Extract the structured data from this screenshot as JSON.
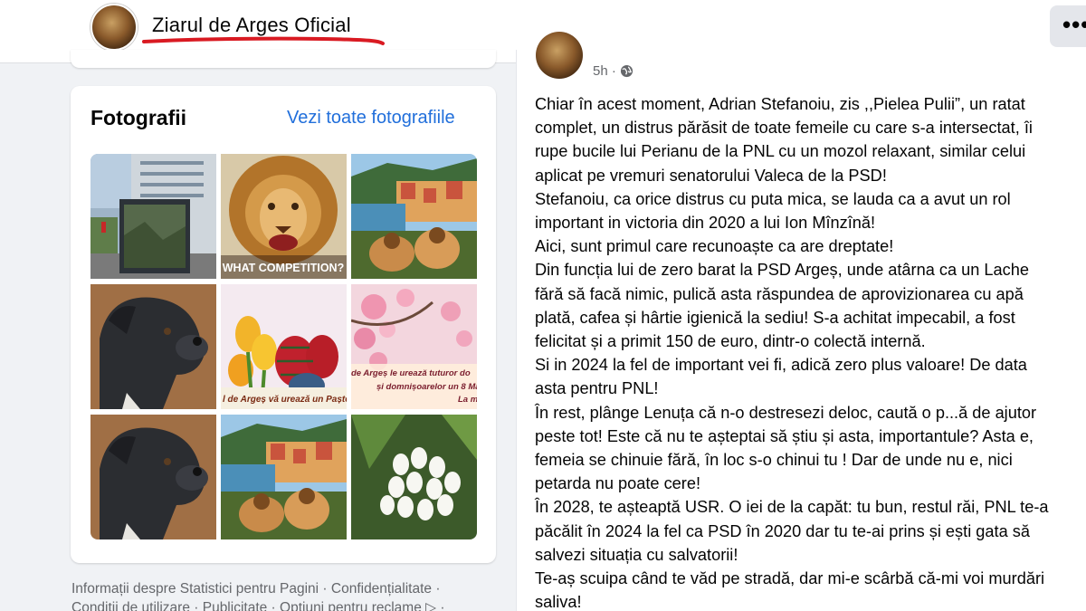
{
  "header": {
    "page_name": "Ziarul de Arges Oficial",
    "more_label": "•••",
    "underline_color": "#d91a22"
  },
  "photos": {
    "title": "Fotografii",
    "see_all": "Vezi toate fotografiile",
    "items": [
      {
        "caption": ""
      },
      {
        "caption": "WHAT COMPETITION?"
      },
      {
        "caption": ""
      },
      {
        "caption": ""
      },
      {
        "caption": "l de Argeș vă urează un Paște"
      },
      {
        "caption_line1": "de Argeș le urează tuturor do",
        "caption_line2": "și domnișoarelor un 8 Mar",
        "caption_line3": "La m"
      },
      {
        "caption": ""
      },
      {
        "caption": ""
      },
      {
        "caption": ""
      }
    ]
  },
  "footer": {
    "line1": "Informații despre Statistici pentru Pagini · Confidențialitate ·",
    "line2": "Condiții de utilizare · Publicitate · Opțiuni pentru reclame ▷ ·"
  },
  "post": {
    "time": "5h ·",
    "lines": [
      "Chiar în acest moment, Adrian Stefanoiu, zis ,,Pielea Pulii”, un ratat",
      "complet, un distrus părăsit de toate femeile cu care s-a intersectat, îi",
      "rupe bucile lui Perianu de la PNL cu un mozol relaxant, similar celui",
      "aplicat pe vremuri senatorului Valeca de la PSD!",
      "Stefanoiu, ca orice distrus cu puta mica, se lauda ca a avut un rol",
      "important in victoria din 2020 a lui Ion Mînzînă!",
      "Aici, sunt primul care recunoaște ca are dreptate!",
      "Din funcția lui de zero barat la PSD Argeș, unde atârna ca un Lache",
      "fără să facă nimic, pulică asta răspundea de aprovizionarea cu apă",
      "plată, cafea și hârtie igienică la sediu! S-a achitat impecabil, a fost",
      "felicitat și a primit 150 de euro, dintr-o colectă internă.",
      "Si in 2024 la fel de important vei fi, adică zero plus valoare! De data",
      "asta pentru PNL!",
      "În rest, plânge Lenuța că n-o destresezi deloc, caută o  p...ă de ajutor",
      "peste tot! Este că nu te așteptai să știu și asta, importantule? Asta e,",
      "femeia se chinuie fără, în loc s-o chinui tu ! Dar de unde nu e, nici",
      "petarda nu poate cere!",
      "În 2028, te așteaptă USR. O iei de la capăt: tu bun, restul răi, PNL te-a",
      "păcălit în 2024 la fel ca PSD în 2020 dar tu te-ai prins și ești gata să",
      "salvezi situația cu salvatorii!",
      "Te-aș scuipa când te văd pe stradă, dar mi-e scârbă că-mi  voi murdări",
      "saliva!"
    ]
  }
}
